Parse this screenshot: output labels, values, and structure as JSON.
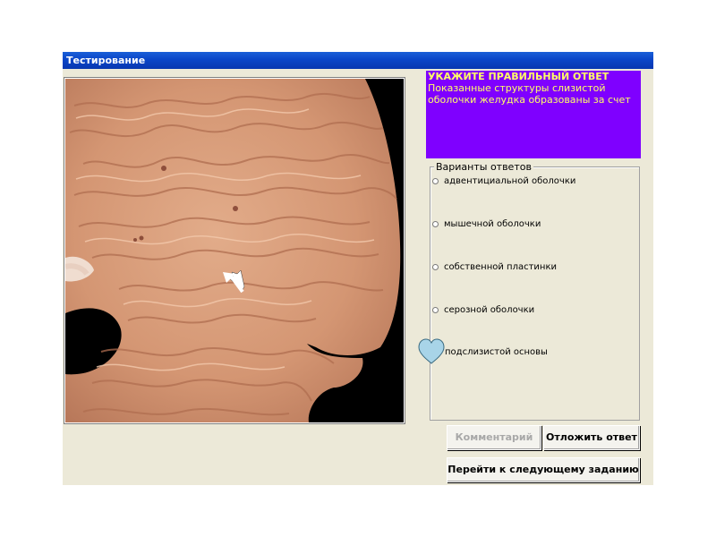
{
  "window": {
    "title": "Тестирование"
  },
  "question": {
    "heading": "УКАЖИТЕ ПРАВИЛЬНЫЙ ОТВЕТ",
    "text": "Показанные структуры слизистой оболочки желудка образованы за счет",
    "background_color": "#7f00ff",
    "text_color": "#ffff66"
  },
  "answers": {
    "legend": "Варианты ответов",
    "options": [
      {
        "label": "адвентициальной оболочки",
        "selected": false
      },
      {
        "label": "мышечной оболочки",
        "selected": false
      },
      {
        "label": "собственной пластинки",
        "selected": false
      },
      {
        "label": "серозной оболочки",
        "selected": false
      },
      {
        "label": "подслизистой основы",
        "selected": false
      }
    ]
  },
  "buttons": {
    "comment": "Комментарий",
    "postpone": "Отложить ответ",
    "next": "Перейти к следующему заданию"
  },
  "image": {
    "icon": "arrow-pointer-icon"
  },
  "cursor": {
    "icon": "heart-cursor-icon",
    "color": "#a8d4e8"
  }
}
